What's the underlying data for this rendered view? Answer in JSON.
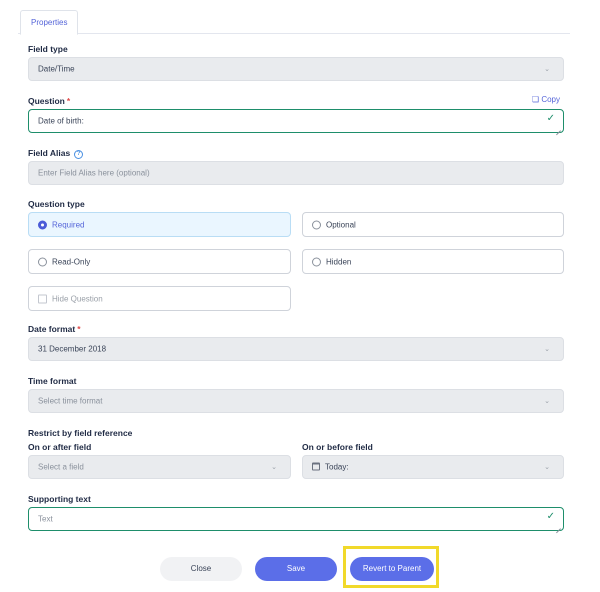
{
  "tabs": [
    {
      "label": "Properties"
    }
  ],
  "field_type": {
    "label": "Field type",
    "value": "Date/Time"
  },
  "question": {
    "label": "Question",
    "required_mark": "*",
    "value": "Date of birth:",
    "copy_label": "Copy"
  },
  "field_alias": {
    "label": "Field Alias",
    "help_glyph": "?",
    "placeholder": "Enter Field Alias here (optional)"
  },
  "question_type": {
    "label": "Question type",
    "options": [
      {
        "label": "Required",
        "selected": true
      },
      {
        "label": "Optional",
        "selected": false
      },
      {
        "label": "Read-Only",
        "selected": false
      },
      {
        "label": "Hidden",
        "selected": false
      }
    ],
    "hide_question": {
      "label": "Hide Question",
      "checked": false
    }
  },
  "date_format": {
    "label": "Date format",
    "required_mark": "*",
    "value": "31 December 2018"
  },
  "time_format": {
    "label": "Time format",
    "placeholder": "Select time format"
  },
  "restrict": {
    "label": "Restrict by field reference",
    "after": {
      "label": "On or after field",
      "placeholder": "Select a field"
    },
    "before": {
      "label": "On or before field",
      "value": "Today:"
    }
  },
  "supporting_text": {
    "label": "Supporting text",
    "placeholder": "Text"
  },
  "actions": {
    "close": "Close",
    "save": "Save",
    "revert": "Revert to Parent"
  },
  "icons": {
    "dropdown": "chevron-down-icon",
    "valid": "checkmark-icon",
    "copy": "copy-icon",
    "help": "help-circle-icon",
    "calendar": "calendar-icon"
  },
  "colors": {
    "accent": "#5b6ee8",
    "valid_green": "#1e8e6b",
    "required_red": "#e04a4a",
    "highlight": "#f1d92a"
  }
}
